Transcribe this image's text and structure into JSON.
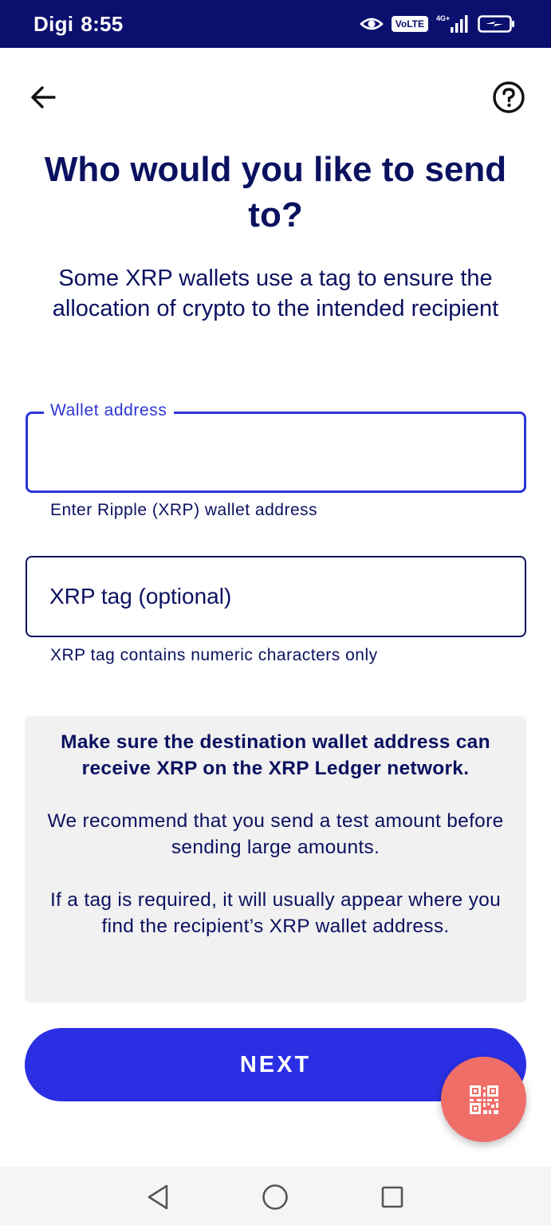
{
  "status_bar": {
    "carrier": "Digi",
    "time": "8:55",
    "volte_label": "VoLTE",
    "network_label": "4G+"
  },
  "header": {
    "title": "Who would you like to send to?",
    "subtitle": "Some XRP wallets use a tag to ensure the allocation of crypto to the intended recipient"
  },
  "wallet_field": {
    "label": "Wallet address",
    "value": "",
    "helper": "Enter Ripple (XRP) wallet address"
  },
  "tag_field": {
    "placeholder": "XRP tag (optional)",
    "value": "",
    "helper": "XRP tag contains numeric characters only"
  },
  "info": {
    "warning": "Make sure the destination wallet address can receive XRP on the XRP Ledger network.",
    "recommendation": "We recommend that you send a test amount before sending large amounts.",
    "tag_hint": "If a tag is required, it will usually appear where you find the recipient’s XRP wallet address."
  },
  "actions": {
    "next_label": "NEXT"
  },
  "icons": {
    "back": "arrow-left-icon",
    "help": "help-circle-icon",
    "qr": "qr-code-icon"
  },
  "colors": {
    "status_bar": "#0b0f6e",
    "text": "#0b1160",
    "primary": "#2a2fe3",
    "fab": "#ef6e68",
    "info_bg": "#f1f1f1"
  }
}
